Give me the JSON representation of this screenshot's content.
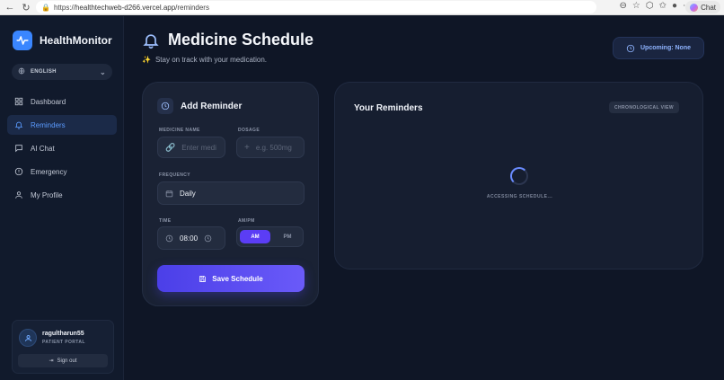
{
  "browser": {
    "url_prefix": "https://",
    "url_host": "healthtechweb-d266.vercel.app",
    "url_path": "/reminders",
    "chat_label": "Chat"
  },
  "sidebar": {
    "brand": "HealthMonitor",
    "language": "ENGLISH",
    "items": [
      {
        "label": "Dashboard",
        "icon": "grid-icon"
      },
      {
        "label": "Reminders",
        "icon": "bell-icon",
        "active": true
      },
      {
        "label": "AI Chat",
        "icon": "chat-icon"
      },
      {
        "label": "Emergency",
        "icon": "alert-icon"
      },
      {
        "label": "My Profile",
        "icon": "user-icon"
      }
    ],
    "user": {
      "name": "ragultharun55",
      "role": "PATIENT PORTAL"
    },
    "signout": "Sign out"
  },
  "header": {
    "title": "Medicine Schedule",
    "subtitle": "Stay on track with your medication.",
    "upcoming": "Upcoming: None"
  },
  "add_reminder": {
    "title": "Add Reminder",
    "medicine_label": "MEDICINE NAME",
    "medicine_placeholder": "Enter medi",
    "dosage_label": "DOSAGE",
    "dosage_placeholder": "e.g. 500mg",
    "frequency_label": "FREQUENCY",
    "frequency_value": "Daily",
    "time_label": "TIME",
    "time_value": "08:00",
    "ampm_label": "AM/PM",
    "am": "AM",
    "pm": "PM",
    "save": "Save Schedule"
  },
  "reminders": {
    "title": "Your Reminders",
    "view": "CHRONOLOGICAL VIEW",
    "loading": "ACCESSING SCHEDULE..."
  },
  "colors": {
    "accent": "#5b3df5",
    "active_nav": "#5b9bff",
    "background": "#0f1626"
  }
}
